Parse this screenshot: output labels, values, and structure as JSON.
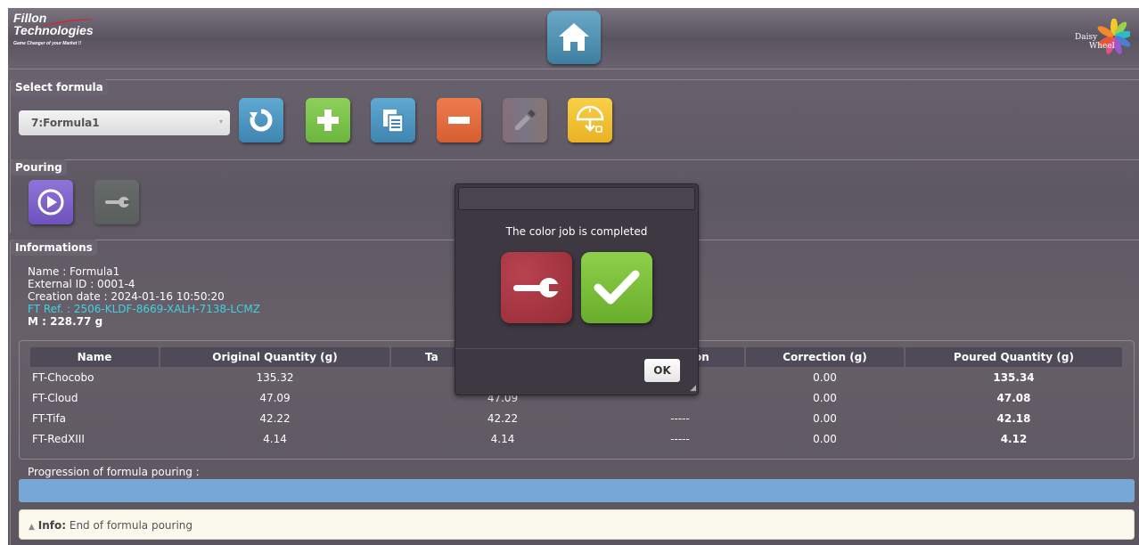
{
  "header": {
    "brand_line1": "Fillon",
    "brand_line2": "Technologies",
    "brand_tagline": "Game Changer of your Market !!",
    "home_icon": "home-icon",
    "partner_logo_line1": "Daisy",
    "partner_logo_line2": "Wheel"
  },
  "formula_section": {
    "legend": "Select formula",
    "selected_formula": "7:Formula1",
    "buttons": [
      {
        "icon": "refresh-icon",
        "color": "#4a95c0"
      },
      {
        "icon": "plus-icon",
        "color": "#77c24a"
      },
      {
        "icon": "copy-icon",
        "color": "#4a95c0"
      },
      {
        "icon": "minus-icon",
        "color": "#e2683a"
      },
      {
        "icon": "dropper-icon",
        "color": "#9a7f86"
      },
      {
        "icon": "scale-icon",
        "color": "#f2c12e"
      }
    ]
  },
  "pouring_section": {
    "legend": "Pouring",
    "buttons": [
      {
        "icon": "play-icon",
        "color": "#7f63c9"
      },
      {
        "icon": "wrench-icon",
        "color": "#5e6a62"
      }
    ]
  },
  "info_section": {
    "legend": "Informations",
    "name": "Name : Formula1",
    "external_id": "External ID : 0001-4",
    "creation_date": "Creation date : 2024-01-16 10:50:20",
    "ft_ref": "FT Ref. : 2506-KLDF-8669-XALH-7138-LCMZ",
    "mass": "M : 228.77 g"
  },
  "table": {
    "headers": [
      "Name",
      "Original Quantity (g)",
      "Ta",
      "on",
      "Correction (g)",
      "Poured Quantity (g)"
    ],
    "rows": [
      [
        "FT-Chocobo",
        "135.32",
        "",
        "",
        "0.00",
        "135.34"
      ],
      [
        "FT-Cloud",
        "47.09",
        "47.09",
        "",
        "0.00",
        "47.08"
      ],
      [
        "FT-Tifa",
        "42.22",
        "42.22",
        "-----",
        "0.00",
        "42.18"
      ],
      [
        "FT-RedXIII",
        "4.14",
        "4.14",
        "-----",
        "0.00",
        "4.12"
      ]
    ]
  },
  "progress": {
    "label": "Progression of formula pouring :",
    "fraction": 1.0
  },
  "infobar": {
    "icon": "warning-icon",
    "prefix": "Info:",
    "message": "End of formula pouring"
  },
  "modal": {
    "message": "The color job is completed",
    "ok_label": "OK",
    "maintenance_icon": "wrench-icon",
    "confirm_icon": "check-icon",
    "maintenance_color": "#a73a45",
    "confirm_color": "#7cbd3a"
  }
}
